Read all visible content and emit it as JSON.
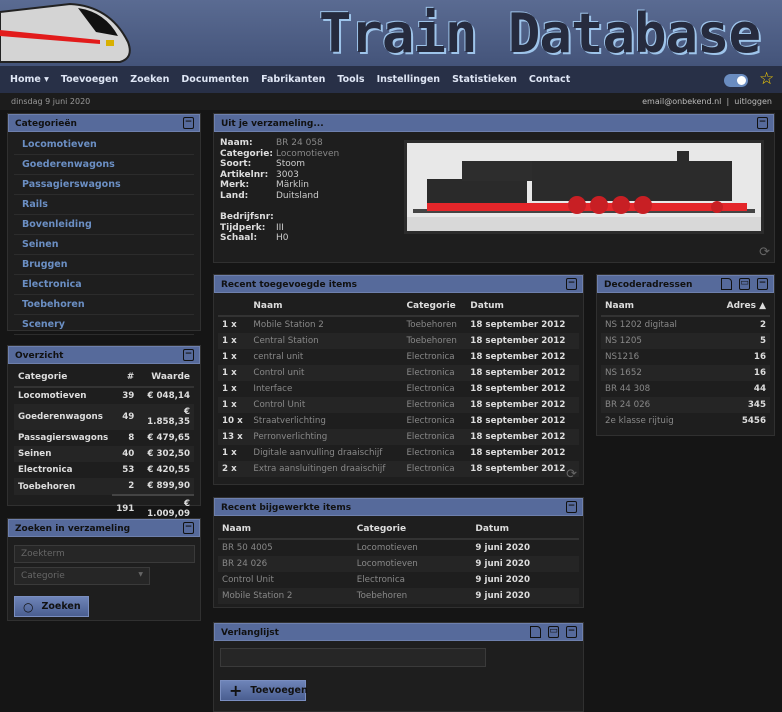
{
  "header": {
    "title": "Train Database"
  },
  "nav": {
    "items": [
      "Home ▾",
      "Toevoegen",
      "Zoeken",
      "Documenten",
      "Fabrikanten",
      "Tools",
      "Instellingen",
      "Statistieken",
      "Contact"
    ]
  },
  "subbar": {
    "date": "dinsdag 9 juni 2020",
    "email": "email@onbekend.nl",
    "sep": "|",
    "logout": "uitloggen"
  },
  "categories": {
    "title": "Categorieën",
    "items": [
      "Locomotieven",
      "Goederenwagons",
      "Passagierswagons",
      "Rails",
      "Bovenleiding",
      "Seinen",
      "Bruggen",
      "Electronica",
      "Toebehoren",
      "Scenery"
    ]
  },
  "overview": {
    "title": "Overzicht",
    "headers": [
      "Categorie",
      "#",
      "Waarde"
    ],
    "rows": [
      [
        "Locomotieven",
        "39",
        "€ 048,14"
      ],
      [
        "Goederenwagons",
        "49",
        "€ 1.858,35"
      ],
      [
        "Passagierswagons",
        "8",
        "€ 479,65"
      ],
      [
        "Seinen",
        "40",
        "€ 302,50"
      ],
      [
        "Electronica",
        "53",
        "€ 420,55"
      ],
      [
        "Toebehoren",
        "2",
        "€ 899,90"
      ]
    ],
    "total_count": "191",
    "total_value": "€ 1.009,09"
  },
  "search": {
    "title": "Zoeken in verzameling",
    "placeholder": "Zoekterm",
    "category": "Categorie",
    "button": "Zoeken"
  },
  "featured": {
    "title": "Uit je verzameling...",
    "fields": [
      [
        "Naam:",
        "BR 24 058"
      ],
      [
        "Categorie:",
        "Locomotieven"
      ],
      [
        "Soort:",
        "Stoom"
      ],
      [
        "Artikelnr:",
        "3003"
      ],
      [
        "Merk:",
        "Märklin"
      ],
      [
        "Land:",
        "Duitsland"
      ],
      [
        "",
        ""
      ],
      [
        "Bedrijfsnr:",
        ""
      ],
      [
        "Tijdperk:",
        "III"
      ],
      [
        "Schaal:",
        "H0"
      ]
    ]
  },
  "recent_added": {
    "title": "Recent toegevoegde items",
    "headers": [
      "",
      "Naam",
      "Categorie",
      "Datum"
    ],
    "rows": [
      [
        "1 x",
        "Mobile Station 2",
        "Toebehoren",
        "18 september 2012"
      ],
      [
        "1 x",
        "Central Station",
        "Toebehoren",
        "18 september 2012"
      ],
      [
        "1 x",
        "central unit",
        "Electronica",
        "18 september 2012"
      ],
      [
        "1 x",
        "Control unit",
        "Electronica",
        "18 september 2012"
      ],
      [
        "1 x",
        "Interface",
        "Electronica",
        "18 september 2012"
      ],
      [
        "1 x",
        "Control Unit",
        "Electronica",
        "18 september 2012"
      ],
      [
        "10 x",
        "Straatverlichting",
        "Electronica",
        "18 september 2012"
      ],
      [
        "13 x",
        "Perronverlichting",
        "Electronica",
        "18 september 2012"
      ],
      [
        "1 x",
        "Digitale aanvulling draaischijf",
        "Electronica",
        "18 september 2012"
      ],
      [
        "2 x",
        "Extra aansluitingen draaischijf",
        "Electronica",
        "18 september 2012"
      ]
    ]
  },
  "decoders": {
    "title": "Decoderadressen",
    "headers": [
      "Naam",
      "Adres ▲"
    ],
    "rows": [
      [
        "NS 1202 digitaal",
        "2"
      ],
      [
        "NS 1205",
        "5"
      ],
      [
        "NS1216",
        "16"
      ],
      [
        "NS 1652",
        "16"
      ],
      [
        "BR 44 308",
        "44"
      ],
      [
        "BR 24 026",
        "345"
      ],
      [
        "2e klasse rijtuig",
        "5456"
      ]
    ]
  },
  "recent_edited": {
    "title": "Recent bijgewerkte items",
    "headers": [
      "Naam",
      "Categorie",
      "Datum"
    ],
    "rows": [
      [
        "BR 50 4005",
        "Locomotieven",
        "9 juni 2020"
      ],
      [
        "BR 24 026",
        "Locomotieven",
        "9 juni 2020"
      ],
      [
        "Control Unit",
        "Electronica",
        "9 juni 2020"
      ],
      [
        "Mobile Station 2",
        "Toebehoren",
        "9 juni 2020"
      ]
    ]
  },
  "wishlist": {
    "title": "Verlanglijst",
    "button": "Toevoegen"
  },
  "colors": {
    "panel_header": "#566a9b",
    "link": "#6b8fc4",
    "nav": "#283047"
  }
}
